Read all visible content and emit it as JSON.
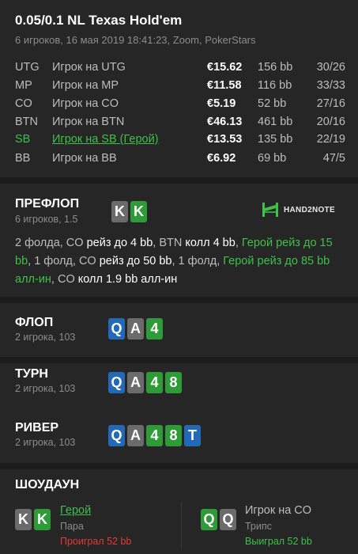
{
  "header": {
    "title": "0.05/0.1 NL Texas Hold'em",
    "info": "6 игроков, 16 мая 2019 18:41:23, Zoom, PokerStars"
  },
  "players": [
    {
      "pos": "UTG",
      "name": "Игрок на UTG",
      "stack": "€15.62",
      "bb": "156 bb",
      "dot": "·",
      "stats": "30/26",
      "hero": false
    },
    {
      "pos": "MP",
      "name": "Игрок на MP",
      "stack": "€11.58",
      "bb": "116 bb",
      "dot": "·",
      "stats": "33/33",
      "hero": false
    },
    {
      "pos": "CO",
      "name": "Игрок на CO",
      "stack": "€5.19",
      "bb": "52 bb",
      "dot": "·",
      "stats": "27/16",
      "hero": false
    },
    {
      "pos": "BTN",
      "name": "Игрок на BTN",
      "stack": "€46.13",
      "bb": "461 bb",
      "dot": "·",
      "stats": "20/16",
      "hero": false
    },
    {
      "pos": "SB",
      "name": "Игрок на SB (Герой)",
      "stack": "€13.53",
      "bb": "135 bb",
      "dot": "·",
      "stats": "22/19",
      "hero": true
    },
    {
      "pos": "BB",
      "name": "Игрок на BB",
      "stack": "€6.92",
      "bb": "69 bb",
      "dot": "·",
      "stats": "47/5",
      "hero": false
    }
  ],
  "preflop": {
    "title": "ПРЕФЛОП",
    "sub": "6 игроков, 1.5",
    "hero_cards": [
      "K",
      "K"
    ],
    "logo_text": "HAND2NOTE",
    "a1": "2 фолда, CO ",
    "a2": "рейз до 4 bb",
    "a3": ", BTN ",
    "a4": "колл 4 bb",
    "a5": ", ",
    "a6": "Герой рейз до 15 bb",
    "a7": ", 1 фолд, CO ",
    "a8": "рейз до 50 bb",
    "a9": ", 1 фолд, ",
    "a10": "Герой рейз до 85 bb алл-ин",
    "a11": ", CO ",
    "a12": "колл 1.9 bb алл-ин"
  },
  "flop": {
    "title": "ФЛОП",
    "sub": "2 игрока, 103"
  },
  "turn": {
    "title": "ТУРН",
    "sub": "2 игрока, 103"
  },
  "river": {
    "title": "РИВЕР",
    "sub": "2 игрока, 103"
  },
  "board": [
    "Q",
    "A",
    "4",
    "8",
    "T"
  ],
  "showdown": {
    "title": "ШОУДАУН",
    "hero": {
      "name": "Герой",
      "hand": "Пара",
      "result": "Проиграл 52 bb",
      "cards": [
        "K",
        "K"
      ]
    },
    "villain": {
      "name": "Игрок на CO",
      "hand": "Трипс",
      "result": "Выиграл 52 bb",
      "cards": [
        "Q",
        "Q"
      ]
    }
  },
  "colors": {
    "background": "#1c1c1c",
    "panel": "#262626",
    "hero_green": "#3ec04a",
    "card_gray": "#6b6b6b",
    "card_green": "#2e9a38",
    "card_blue": "#2468b8",
    "loss_red": "#e53935"
  }
}
